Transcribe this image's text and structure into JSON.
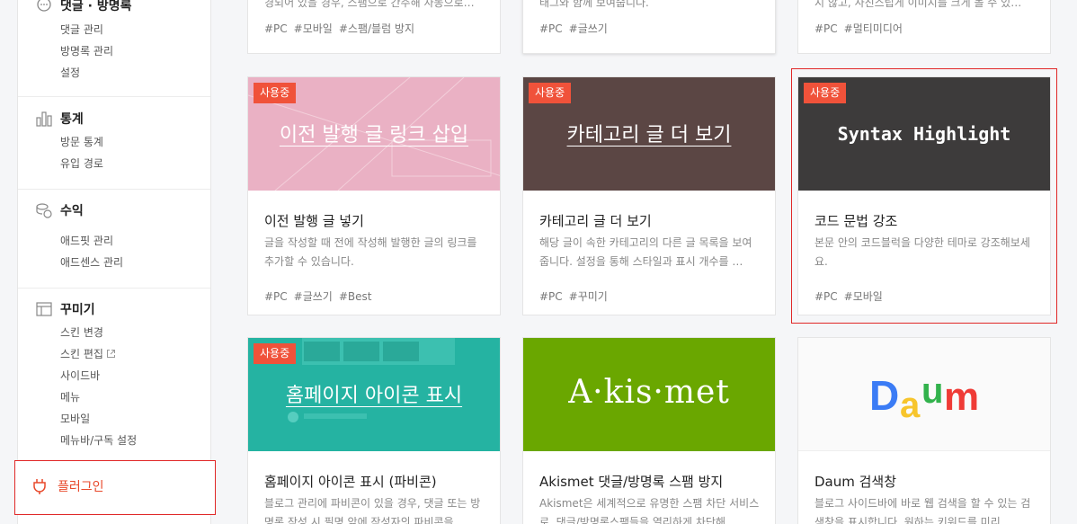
{
  "sidebar": {
    "comments": {
      "title": "댓글 · 방명록",
      "items": [
        "댓글 관리",
        "방명록 관리",
        "설정"
      ]
    },
    "stats": {
      "title": "통계",
      "items": [
        "방문 통계",
        "유입 경로"
      ]
    },
    "revenue": {
      "title": "수익",
      "items": [
        "애드핏 관리",
        "애드센스 관리"
      ]
    },
    "decorate": {
      "title": "꾸미기",
      "items": [
        "스킨 변경",
        "스킨 편집",
        "사이드바",
        "메뉴",
        "모바일",
        "메뉴바/구독 설정"
      ]
    },
    "plugin": {
      "label": "플러그인"
    }
  },
  "top_cards": [
    {
      "desc": "경되어 있을 경우, 스팸으로 간주해 자동으로…",
      "tags": [
        "#PC",
        "#모바일",
        "#스팸/블럼 방지"
      ]
    },
    {
      "desc": "태그와 함께 보여줍니다.",
      "tags": [
        "#PC",
        "#글쓰기"
      ]
    },
    {
      "desc": "지 않고, 사진스립게 이미지를 크게 볼 수 있…",
      "tags": [
        "#PC",
        "#멀티미디어"
      ]
    }
  ],
  "cards": [
    {
      "badge": "사용중",
      "thumb_text": "이전 발행 글 링크 삽입",
      "title": "이전 발행 글 넣기",
      "desc": "글을 작성할 때 전에 작성해 발행한 글의 링크를 추가할 수 있습니다.",
      "tags": [
        "#PC",
        "#글쓰기",
        "#Best"
      ]
    },
    {
      "badge": "사용중",
      "thumb_text": "카테고리 글 더 보기",
      "title": "카테고리 글 더 보기",
      "desc": "해당 글이 속한 카테고리의 다른 글 목록을 보여줍니다. 설정을 통해 스타일과 표시 개수를 …",
      "tags": [
        "#PC",
        "#꾸미기"
      ]
    },
    {
      "badge": "사용중",
      "thumb_text": "Syntax Highlight",
      "title": "코드 문법 강조",
      "desc": "본문 안의 코드블럭을 다양한 테마로 강조해보세요.",
      "tags": [
        "#PC",
        "#모바일"
      ]
    },
    {
      "badge": "사용중",
      "thumb_text": "홈페이지 아이콘 표시",
      "title": "홈페이지 아이콘 표시 (파비콘)",
      "desc": "블로그 관리에 파비콘이 있을 경우, 댓글 또는 방명록 작성 시 필명 앞에 작성자의 파비콘을 …",
      "tags": []
    },
    {
      "badge": "",
      "thumb_text": "A·kis·met",
      "title": "Akismet 댓글/방명록 스팸 방지",
      "desc": "Akismet은 세계적으로 유명한 스팸 차단 서비스로, 댓글/방명록스팸들을 열리하게 차단해 …",
      "tags": []
    },
    {
      "badge": "",
      "thumb_text": "Daum",
      "title": "Daum 검색창",
      "desc": "블로그 사이드바에 바로 웹 검색을 할 수 있는 검색창을 표시합니다. 원하는 키워드를 미리 …",
      "tags": []
    }
  ],
  "colors": {
    "accent": "#f0523a",
    "selection": "#e02727",
    "thumb_pink": "#eab1c4",
    "thumb_brown": "#5b4644",
    "thumb_dark": "#3d3b3b",
    "thumb_teal": "#25b3a2",
    "thumb_green": "#6aa700"
  }
}
